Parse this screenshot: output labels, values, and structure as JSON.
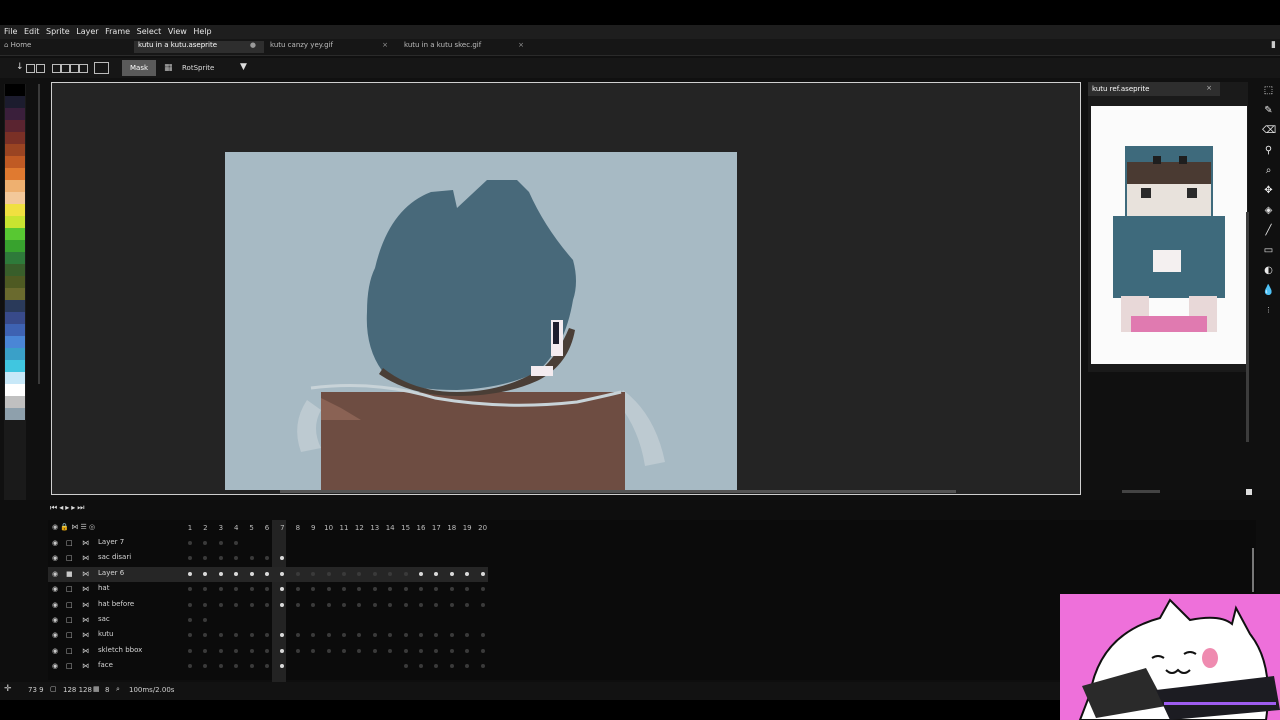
{
  "menu": [
    "File",
    "Edit",
    "Sprite",
    "Layer",
    "Frame",
    "Select",
    "View",
    "Help"
  ],
  "tabs": [
    {
      "label": "Home",
      "close": ""
    },
    {
      "label": "kutu in a kutu.aseprite",
      "close": "●"
    },
    {
      "label": "kutu canzy yey.gif",
      "close": "×"
    },
    {
      "label": "kutu in a kutu skec.gif",
      "close": "×"
    }
  ],
  "toolbar": {
    "mask_label": "Mask",
    "rotation_algorithm": "RotSprite"
  },
  "reference": {
    "tab_label": "kutu ref.aseprite",
    "close": "×"
  },
  "palette": [
    "#000000",
    "#1c1c2e",
    "#3a1f3b",
    "#5a2430",
    "#7a3026",
    "#9a4422",
    "#c05a24",
    "#e07a30",
    "#eeb070",
    "#f3c89a",
    "#f0e040",
    "#c8e430",
    "#58c832",
    "#38a22e",
    "#2e7a3a",
    "#385e2a",
    "#4e5a22",
    "#6a6a2e",
    "#2a3a5a",
    "#384a8a",
    "#3e62b2",
    "#4a86d6",
    "#3aa0c8",
    "#40c6e0",
    "#c8e8f8",
    "#ffffff",
    "#c0c0c0",
    "#8ea0ac"
  ],
  "colors": {
    "foreground_hex": "#4a3e36",
    "background_hex": "#3012a"
  },
  "frames": [
    "1",
    "2",
    "3",
    "4",
    "5",
    "6",
    "7",
    "8",
    "9",
    "10",
    "11",
    "12",
    "13",
    "14",
    "15",
    "16",
    "17",
    "18",
    "19",
    "20"
  ],
  "layers": [
    {
      "name": "Layer 7",
      "locked": false
    },
    {
      "name": "sac disari",
      "locked": false
    },
    {
      "name": "Layer 6",
      "locked": true
    },
    {
      "name": "hat",
      "locked": false
    },
    {
      "name": "hat before",
      "locked": false
    },
    {
      "name": "sac",
      "locked": false
    },
    {
      "name": "kutu",
      "locked": false
    },
    {
      "name": "skletch bbox",
      "locked": false
    },
    {
      "name": "face",
      "locked": false
    }
  ],
  "status": {
    "coords": "73 9",
    "size": "128 128",
    "frame": "8",
    "duration": "100ms/2.00s"
  }
}
